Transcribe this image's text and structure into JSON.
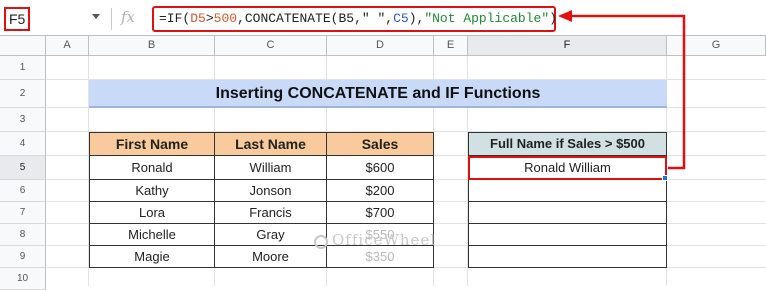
{
  "formula_bar": {
    "name_box": "F5",
    "fx_label": "fx",
    "formula_parts": [
      {
        "text": "=IF(",
        "color": "plain"
      },
      {
        "text": "D5",
        "color": "red"
      },
      {
        "text": ">",
        "color": "plain"
      },
      {
        "text": "500",
        "color": "red"
      },
      {
        "text": ",CONCATENATE(",
        "color": "plain"
      },
      {
        "text": "B5",
        "color": "plain"
      },
      {
        "text": ",\" \",",
        "color": "plain"
      },
      {
        "text": "C5",
        "color": "blue"
      },
      {
        "text": "),",
        "color": "plain"
      },
      {
        "text": "\"Not Applicable\"",
        "color": "green"
      },
      {
        "text": ")",
        "color": "plain"
      }
    ]
  },
  "columns": [
    "A",
    "B",
    "C",
    "D",
    "E",
    "F",
    "G"
  ],
  "rows": [
    "1",
    "2",
    "3",
    "4",
    "5",
    "6",
    "7",
    "8",
    "9",
    "10"
  ],
  "title": "Inserting CONCATENATE and IF Functions",
  "table": {
    "headers": [
      "First Name",
      "Last Name",
      "Sales"
    ],
    "rows": [
      [
        "Ronald",
        "William",
        "$600"
      ],
      [
        "Kathy",
        "Jonson",
        "$200"
      ],
      [
        "Lora",
        "Francis",
        "$700"
      ],
      [
        "Michelle",
        "Gray",
        "$550"
      ],
      [
        "Magie",
        "Moore",
        "$350"
      ]
    ]
  },
  "result_table": {
    "header": "Full Name if Sales > $500",
    "values": [
      "Ronald William",
      "",
      "",
      "",
      ""
    ]
  },
  "watermark": "OfficeWheel",
  "colors": {
    "highlight_red": "#e01010",
    "title_bg": "#c9daf8",
    "header_bg": "#f9cb9c",
    "result_header_bg": "#d0e0e3",
    "selection_blue": "#1a73e8"
  }
}
